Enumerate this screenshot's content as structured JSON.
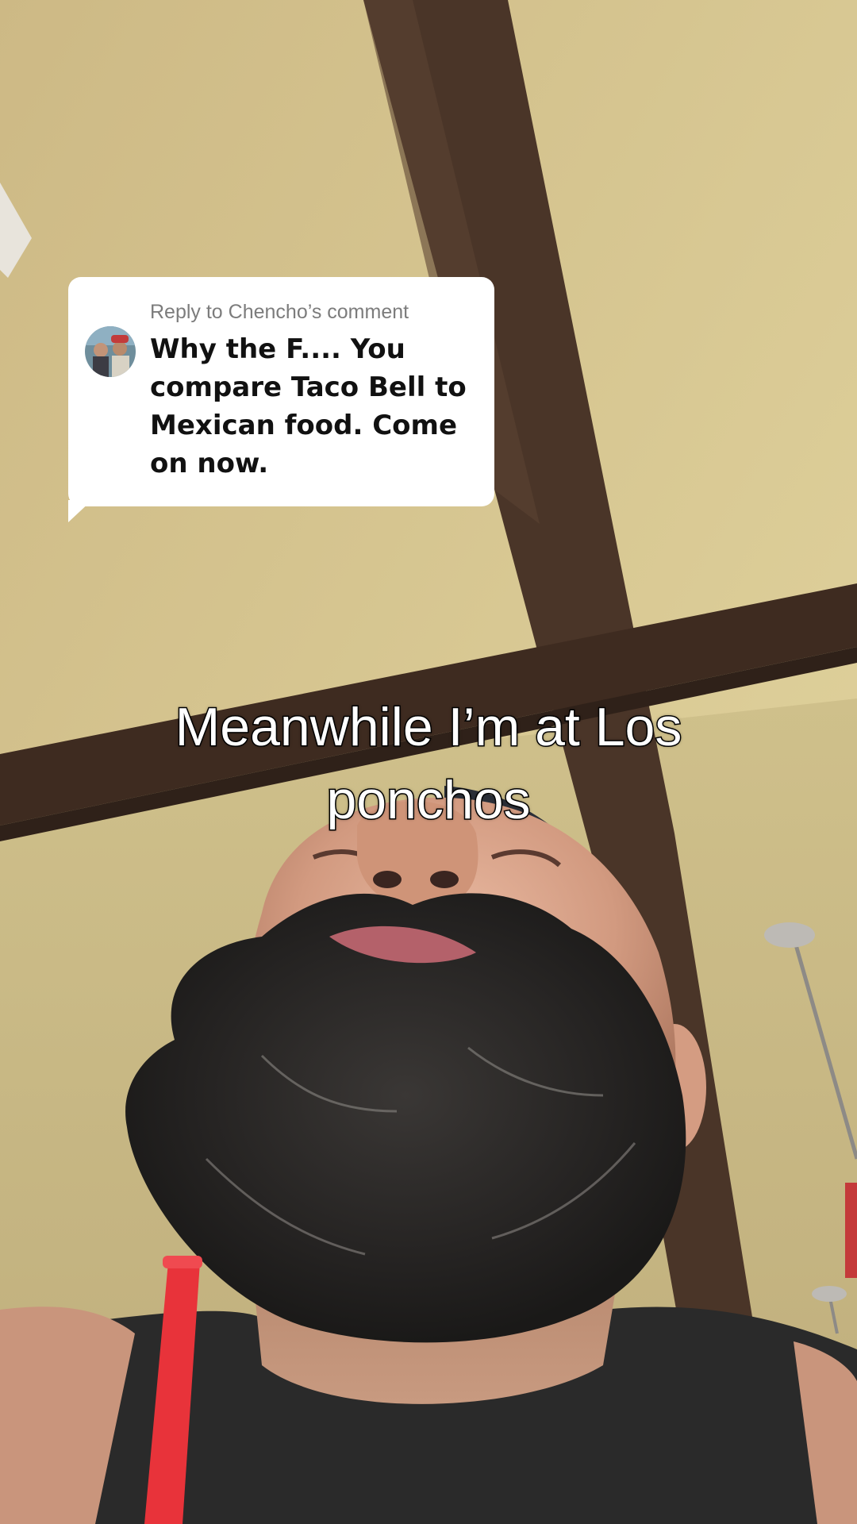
{
  "reply": {
    "header": "Reply to Chencho’s comment",
    "comment": "Why the F.... You compare Taco Bell to Mexican food. Come on now."
  },
  "caption": "Meanwhile I’m at Los ponchos",
  "colors": {
    "ceiling": "#d9c98f",
    "beam": "#4a3528",
    "bubble": "#ffffff",
    "straw": "#e8333a",
    "shirt": "#2a2a2a"
  },
  "icons": {
    "avatar": "commenter-avatar-photo"
  }
}
